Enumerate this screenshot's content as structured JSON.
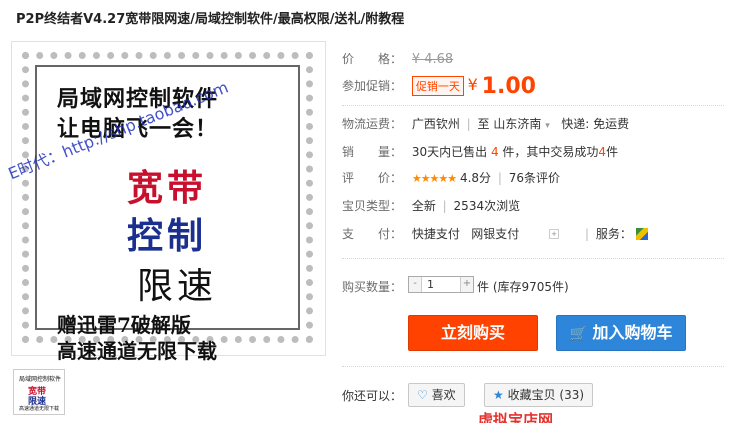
{
  "title": "P2P终结者V4.27宽带限网速/局域控制软件/最高权限/送礼/附教程",
  "image": {
    "line1": "局域网控制软件",
    "line2": "让电脑飞一会！",
    "big1": "宽带",
    "big2": "控制",
    "big3": "限速",
    "line3": "赠迅雷7破解版",
    "line4": "高速通道无限下载",
    "watermark": "E时代：http://shp.taobao.com"
  },
  "thumb": {
    "t1": "局域网控制软件",
    "t2": "宽带",
    "t3": "限速",
    "t4": "高速通道无限下载"
  },
  "price": {
    "label": "价　　格：",
    "original": "¥ 4.68"
  },
  "promo": {
    "label": "参加促销：",
    "tag": "促销一天",
    "currency": "¥",
    "price": "1.00"
  },
  "shipping": {
    "label": "物流运费：",
    "from": "广西钦州",
    "to_word": "至",
    "to": "山东济南",
    "express": "快递: 免运费"
  },
  "sales": {
    "label": "销　　量：",
    "text1": "30天内已售出",
    "sold": "4",
    "text2": "件，其中交易成功",
    "success": "4",
    "text3": "件"
  },
  "rating": {
    "label": "评　　价：",
    "stars": "★★★★★",
    "score": "4.8分",
    "reviews": "76条评价"
  },
  "item_type": {
    "label": "宝贝类型：",
    "value": "全新",
    "views": "2534次浏览"
  },
  "payment": {
    "label": "支　　付：",
    "method1": "快捷支付",
    "method2": "网银支付",
    "service_label": "服务："
  },
  "quantity": {
    "label": "购买数量：",
    "value": "1",
    "minus": "-",
    "plus": "+",
    "stock": "件 (库存9705件)"
  },
  "buttons": {
    "buy": "立刻购买",
    "cart": "加入购物车",
    "cart_icon": "cart-icon"
  },
  "also": {
    "label": "你还可以：",
    "like": "喜欢",
    "favorite": "收藏宝贝 (33)"
  },
  "bottom_text": "虚拟宝店网"
}
